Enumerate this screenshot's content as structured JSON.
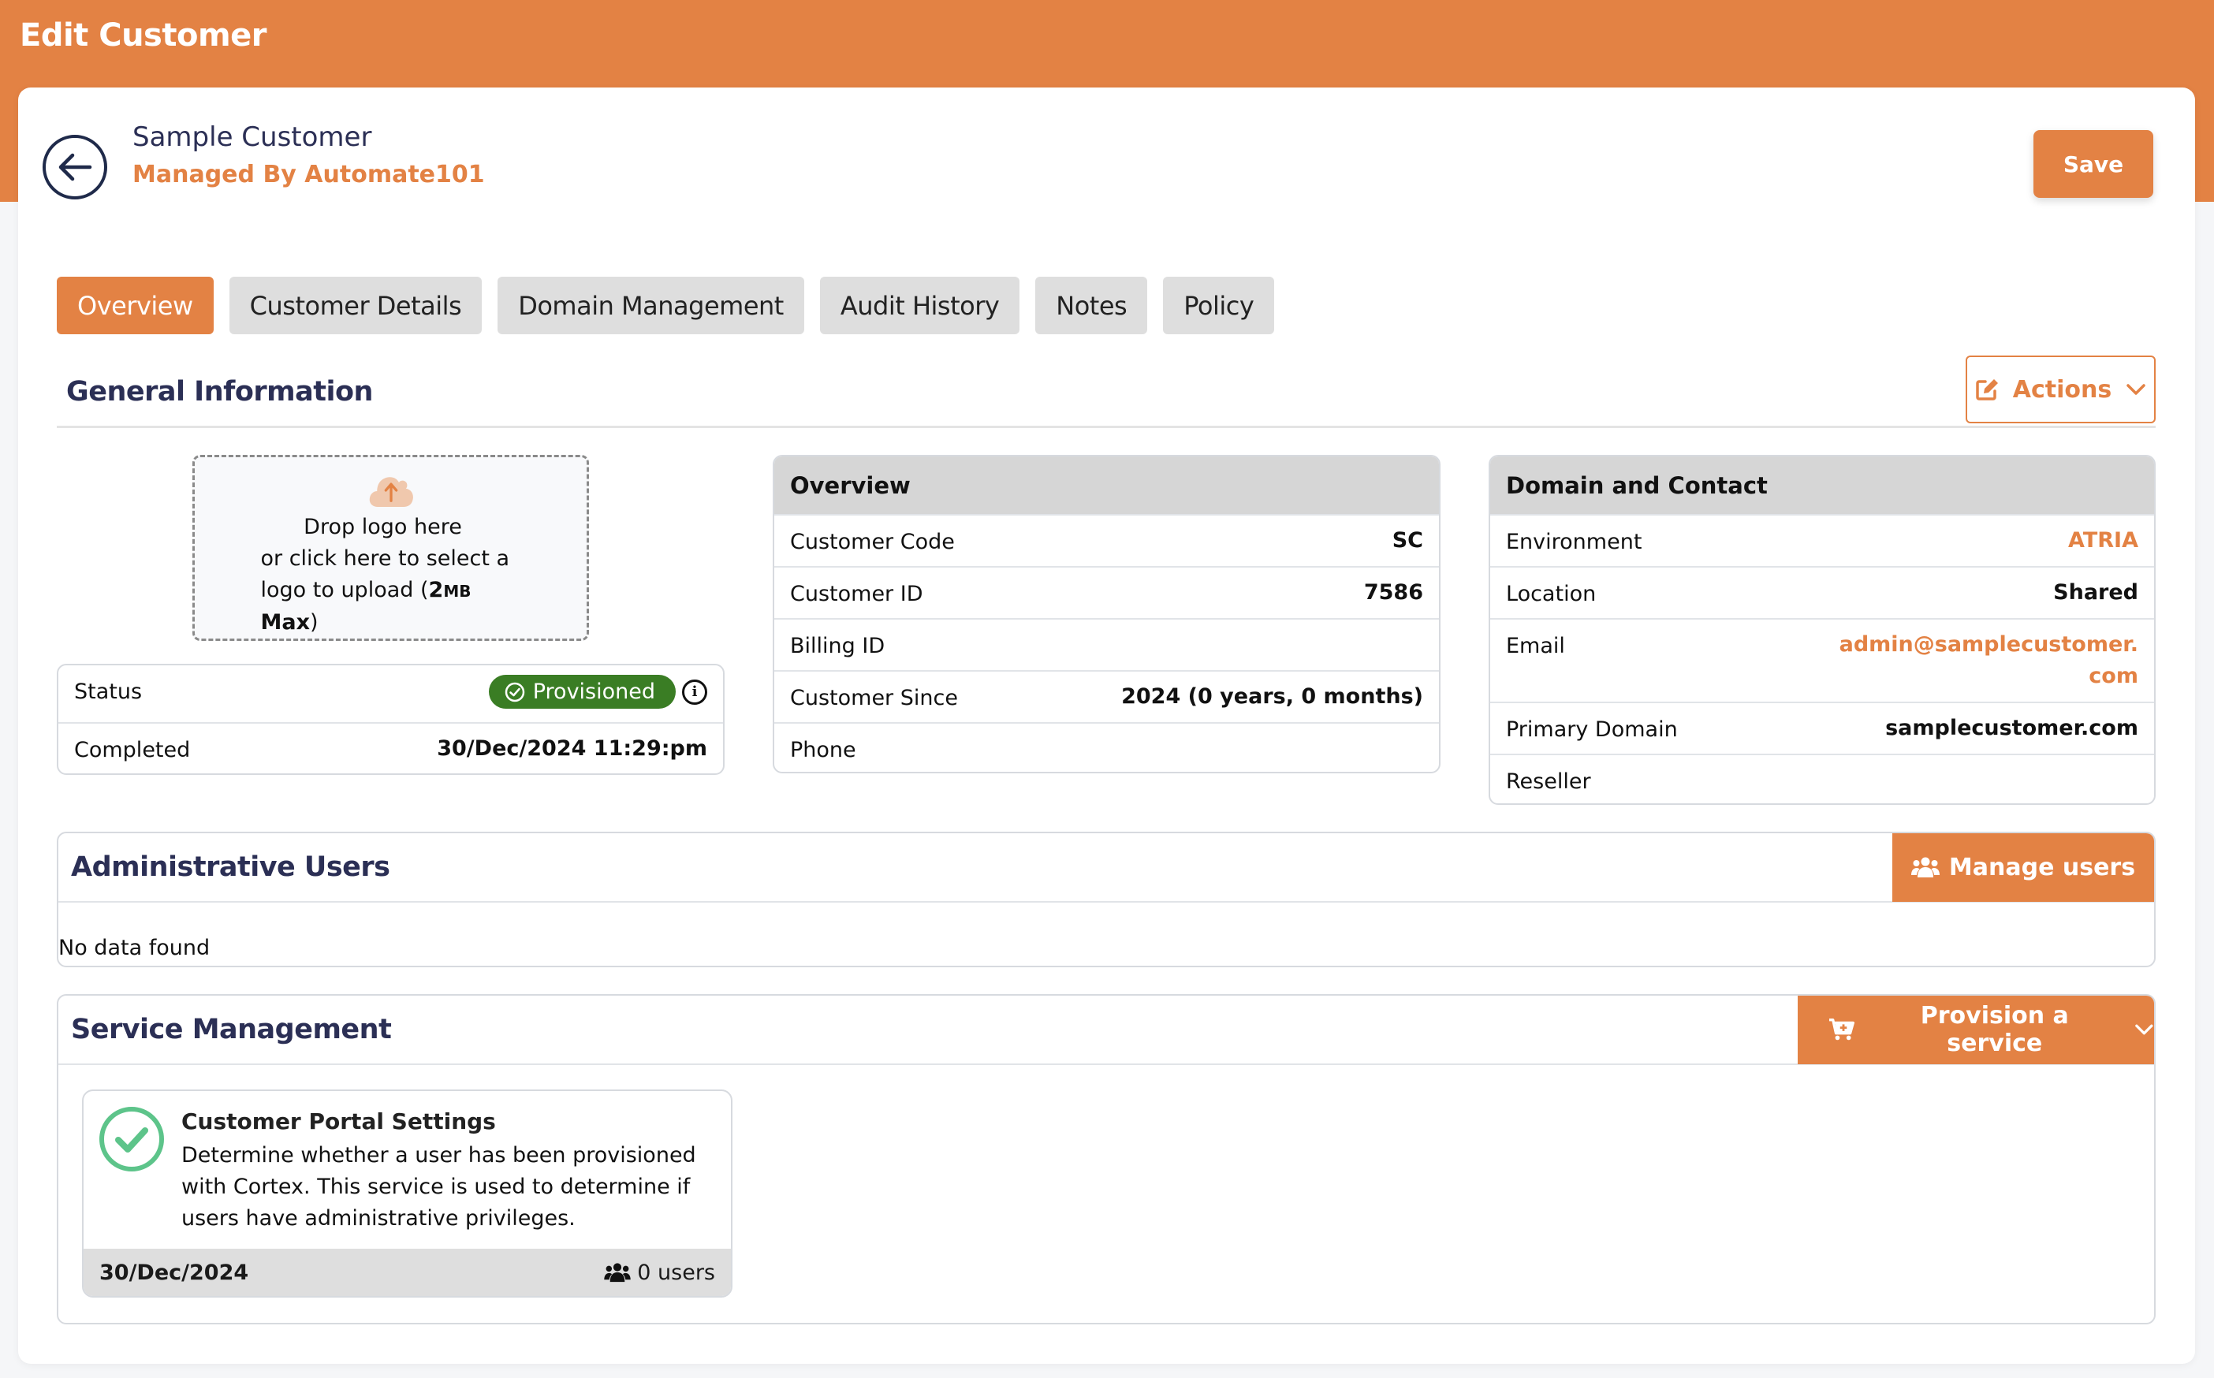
{
  "header": {
    "title": "Edit Customer"
  },
  "customer": {
    "name": "Sample Customer",
    "managed_by": "Managed By Automate101",
    "back_icon": "arrow-left-circle-icon"
  },
  "toolbar": {
    "save_label": "Save"
  },
  "tabs": [
    {
      "label": "Overview",
      "active": true
    },
    {
      "label": "Customer Details",
      "active": false
    },
    {
      "label": "Domain Management",
      "active": false
    },
    {
      "label": "Audit History",
      "active": false
    },
    {
      "label": "Notes",
      "active": false
    },
    {
      "label": "Policy",
      "active": false
    }
  ],
  "general_information": {
    "title": "General Information",
    "actions_label": "Actions",
    "actions_icon": "edit-icon",
    "upload": {
      "icon": "cloud-upload-icon",
      "line1": "Drop logo here",
      "line2": "or click here to select a",
      "line3_prefix": "logo to upload (",
      "size_number": "2",
      "size_unit": "MB",
      "size_suffix": " Max",
      "line3_close": ")"
    },
    "status": {
      "label": "Status",
      "value": "Provisioned",
      "completed_label": "Completed",
      "completed_value": "30/Dec/2024 11:29:pm"
    }
  },
  "overview_card": {
    "title": "Overview",
    "rows": [
      {
        "label": "Customer Code",
        "value": "SC"
      },
      {
        "label": "Customer ID",
        "value": "7586"
      },
      {
        "label": "Billing ID",
        "value": ""
      },
      {
        "label": "Customer Since",
        "value": "2024 (0 years, 0 months)"
      },
      {
        "label": "Phone",
        "value": ""
      }
    ]
  },
  "domain_card": {
    "title": "Domain and Contact",
    "rows": [
      {
        "label": "Environment",
        "value": "ATRIA"
      },
      {
        "label": "Location",
        "value": "Shared"
      },
      {
        "label": "Email",
        "value": "admin@samplecustomer.com"
      },
      {
        "label": "Primary Domain",
        "value": "samplecustomer.com"
      },
      {
        "label": "Reseller",
        "value": ""
      }
    ]
  },
  "admin_users": {
    "title": "Administrative Users",
    "manage_label": "Manage users",
    "empty_text": "No data found"
  },
  "service_management": {
    "title": "Service Management",
    "provision_label": "Provision a service",
    "services": [
      {
        "title": "Customer Portal Settings",
        "description": "Determine whether a user has been provisioned with Cortex. This service is used to determine if users have administrative privileges.",
        "date": "30/Dec/2024",
        "users": "0 users",
        "status": "provisioned"
      }
    ]
  },
  "colors": {
    "accent": "#e38244",
    "navy": "#2b2f55",
    "success_badge": "#3a7d24",
    "success_check": "#5dc48a"
  }
}
